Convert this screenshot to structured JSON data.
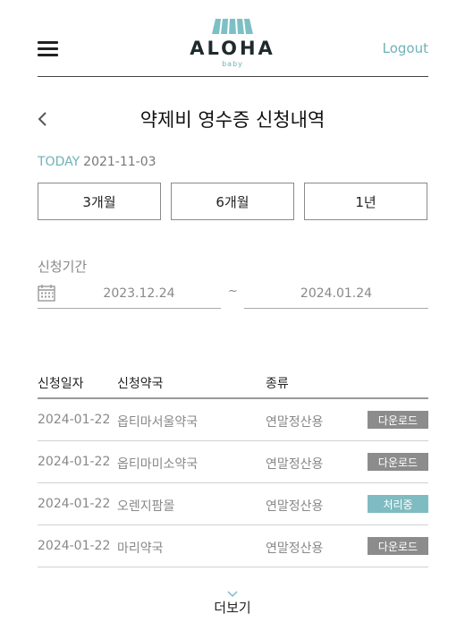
{
  "header": {
    "logo_text": "ALOHA",
    "logo_sub": "baby",
    "logout_label": "Logout"
  },
  "page": {
    "title": "약제비 영수증 신청내역",
    "today_label": "TODAY",
    "today_date": "2021-11-03"
  },
  "period_buttons": [
    "3개월",
    "6개월",
    "1년"
  ],
  "range": {
    "label": "신청기간",
    "start": "2023.12.24",
    "separator": "~",
    "end": "2024.01.24"
  },
  "table": {
    "headers": [
      "신청일자",
      "신청약국",
      "종류"
    ],
    "rows": [
      {
        "date": "2024-01-22",
        "pharmacy": "옵티마서울약국",
        "type": "연말정산용",
        "action": "다운로드",
        "status": "download"
      },
      {
        "date": "2024-01-22",
        "pharmacy": "옵티마미소약국",
        "type": "연말정산용",
        "action": "다운로드",
        "status": "download"
      },
      {
        "date": "2024-01-22",
        "pharmacy": "오렌지팜몰",
        "type": "연말정산용",
        "action": "처리중",
        "status": "processing"
      },
      {
        "date": "2024-01-22",
        "pharmacy": "마리약국",
        "type": "연말정산용",
        "action": "다운로드",
        "status": "download"
      }
    ]
  },
  "more_label": "더보기",
  "colors": {
    "accent": "#6fb2b6",
    "download_badge": "#8c8c8c",
    "processing_badge": "#7fbcc2"
  }
}
